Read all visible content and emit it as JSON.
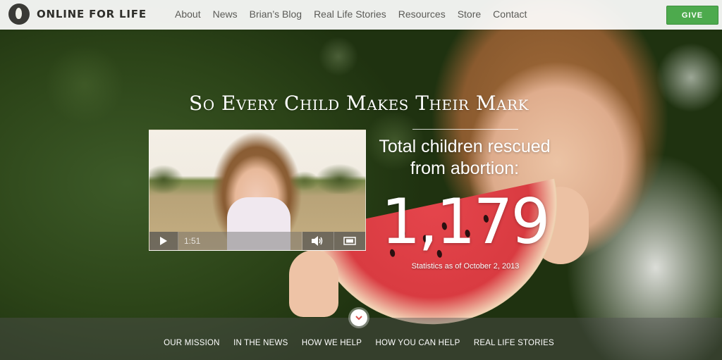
{
  "brand": {
    "name": "ONLINE FOR LIFE"
  },
  "nav": {
    "items": [
      "About",
      "News",
      "Brian’s Blog",
      "Real Life Stories",
      "Resources",
      "Store",
      "Contact"
    ]
  },
  "give": {
    "label": "GIVE",
    "color": "#4daa4d"
  },
  "hero": {
    "headline": "So Every Child Makes Their Mark",
    "stat_label_line1": "Total children rescued",
    "stat_label_line2": "from abortion:",
    "stat_value": "1,179",
    "stat_date": "Statistics as of October 2, 2013"
  },
  "video": {
    "time": "1:51",
    "progress": 0
  },
  "bottom_nav": {
    "items": [
      "OUR MISSION",
      "IN THE NEWS",
      "HOW WE HELP",
      "HOW YOU CAN HELP",
      "REAL LIFE STORIES"
    ]
  }
}
